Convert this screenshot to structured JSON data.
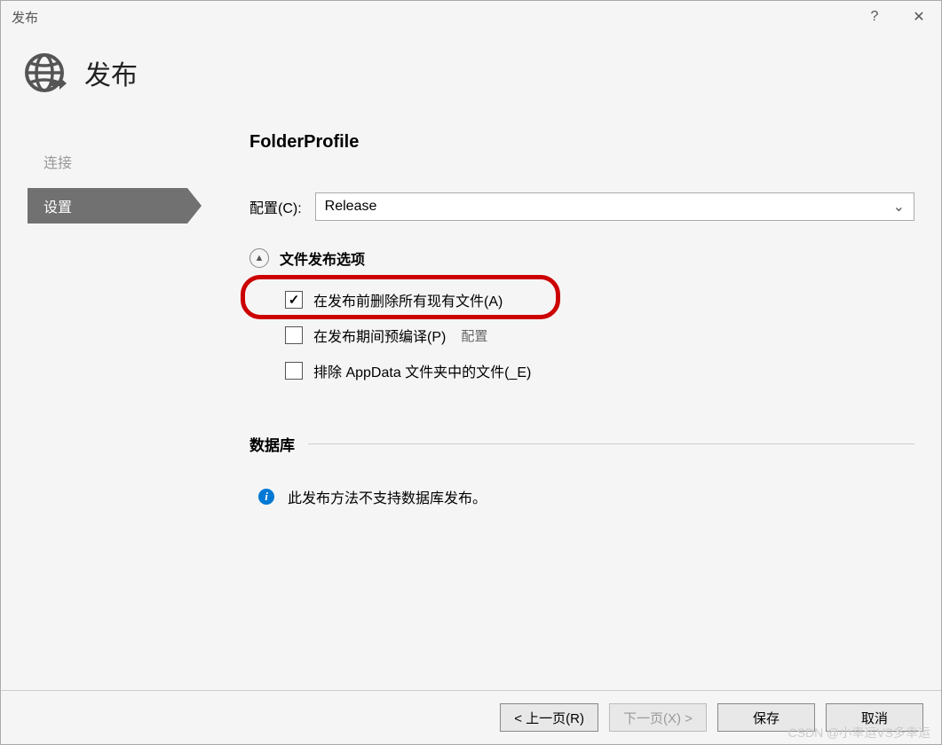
{
  "window": {
    "title": "发布",
    "help": "?",
    "close": "✕"
  },
  "header": {
    "title": "发布"
  },
  "sidebar": {
    "items": [
      {
        "label": "连接",
        "active": false
      },
      {
        "label": "设置",
        "active": true
      }
    ]
  },
  "main": {
    "profile_name": "FolderProfile",
    "config_label": "配置(C):",
    "config_value": "Release",
    "file_options_title": "文件发布选项",
    "options": [
      {
        "label": "在发布前删除所有现有文件(A)",
        "checked": true,
        "link": ""
      },
      {
        "label": "在发布期间预编译(P)",
        "checked": false,
        "link": "配置"
      },
      {
        "label": "排除 AppData 文件夹中的文件(_E)",
        "checked": false,
        "link": ""
      }
    ],
    "database_section": "数据库",
    "database_info": "此发布方法不支持数据库发布。"
  },
  "footer": {
    "prev": "< 上一页(R)",
    "next": "下一页(X) >",
    "save": "保存",
    "cancel": "取消"
  },
  "watermark": "CSDN @小幸运VS多幸运"
}
